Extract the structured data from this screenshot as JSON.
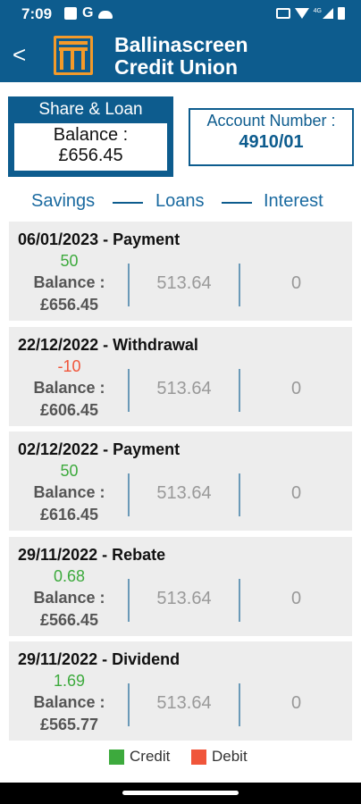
{
  "status_bar": {
    "time": "7:09",
    "g_label": "G",
    "network_label": "4G"
  },
  "header": {
    "title_line1": "Ballinascreen",
    "title_line2": "Credit Union",
    "back_label": "<"
  },
  "share_loan": {
    "title": "Share & Loan",
    "balance_label": "Balance :",
    "balance_value": "£656.45"
  },
  "account": {
    "label": "Account Number :",
    "value": "4910/01"
  },
  "columns": {
    "savings": "Savings",
    "loans": "Loans",
    "interest": "Interest"
  },
  "transactions": [
    {
      "header": "06/01/2023 - Payment",
      "amount": "50",
      "type": "credit",
      "balance_label": "Balance :",
      "balance_value": "£656.45",
      "loans": "513.64",
      "interest": "0"
    },
    {
      "header": "22/12/2022 - Withdrawal",
      "amount": "-10",
      "type": "debit",
      "balance_label": "Balance :",
      "balance_value": "£606.45",
      "loans": "513.64",
      "interest": "0"
    },
    {
      "header": "02/12/2022 - Payment",
      "amount": "50",
      "type": "credit",
      "balance_label": "Balance :",
      "balance_value": "£616.45",
      "loans": "513.64",
      "interest": "0"
    },
    {
      "header": "29/11/2022 - Rebate",
      "amount": "0.68",
      "type": "credit",
      "balance_label": "Balance :",
      "balance_value": "£566.45",
      "loans": "513.64",
      "interest": "0"
    },
    {
      "header": "29/11/2022 - Dividend",
      "amount": "1.69",
      "type": "credit",
      "balance_label": "Balance :",
      "balance_value": "£565.77",
      "loans": "513.64",
      "interest": "0"
    }
  ],
  "legend": {
    "credit_label": "Credit",
    "debit_label": "Debit",
    "credit_color": "#3daa3d",
    "debit_color": "#f0553a"
  },
  "colors": {
    "brand": "#0d5c8e",
    "accent": "#f39a2a"
  }
}
